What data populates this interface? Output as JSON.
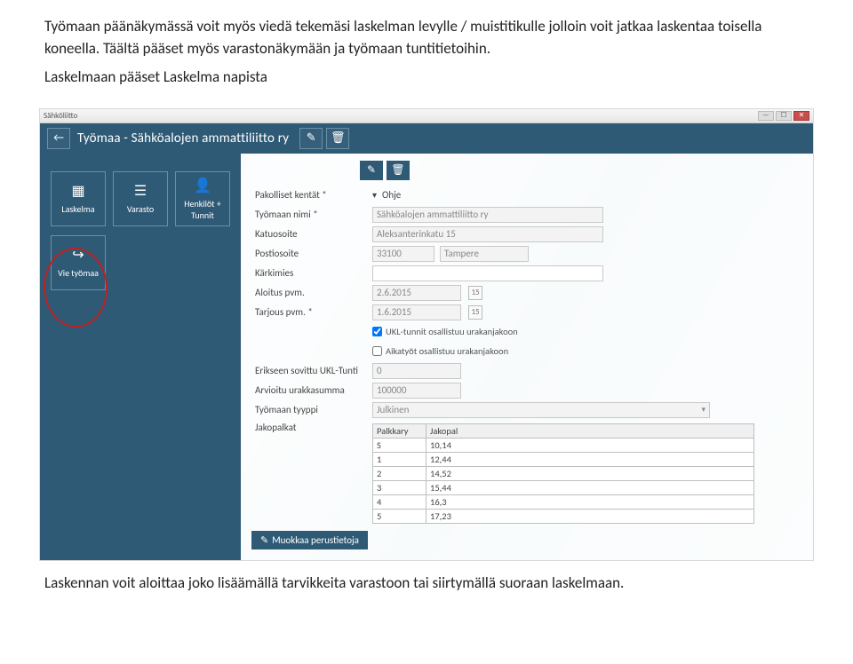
{
  "doc": {
    "p1": "Työmaan päänäkymässä voit myös viedä tekemäsi laskelman levylle / muistitikulle jolloin voit jatkaa laskentaa toisella koneella. Täältä pääset myös varastonäkymään ja työmaan tuntitietoihin.",
    "p2": "Laskelmaan pääset Laskelma napista",
    "p3": "Laskennan voit aloittaa joko lisäämällä tarvikkeita varastoon tai siirtymällä suoraan laskelmaan."
  },
  "window": {
    "app_label": "Sähköliitto",
    "min": "—",
    "max": "☐",
    "close": "✕"
  },
  "header": {
    "back": "←",
    "title": "Työmaa - Sähköalojen ammattiliitto ry",
    "edit": "✎",
    "delete": "🗑"
  },
  "sidebar": {
    "tiles": [
      {
        "icon": "▦",
        "label": "Laskelma"
      },
      {
        "icon": "☰",
        "label": "Varasto"
      },
      {
        "icon": "👤",
        "label": "Henkilöt + Tunnit"
      },
      {
        "icon": "↪",
        "label": "Vie työmaa"
      }
    ]
  },
  "toolbar": {
    "edit": "✎",
    "delete": "🗑"
  },
  "form": {
    "required_label": "Pakolliset kentät *",
    "help_label": "Ohje",
    "name_label": "Työmaan nimi *",
    "name_value": "Sähköalojen ammattiliitto ry",
    "street_label": "Katuosoite",
    "street_value": "Aleksanterinkatu 15",
    "post_label": "Postiosoite",
    "post_zip": "33100",
    "post_city": "Tampere",
    "foreman_label": "Kärkimies",
    "foreman_value": "",
    "start_label": "Aloitus pvm.",
    "start_value": "2.6.2015",
    "offer_label": "Tarjous pvm. *",
    "offer_value": "1.6.2015",
    "chk1": "UKL-tunnit osallistuu urakanjakoon",
    "chk2": "Aikatyöt osallistuu urakanjakoon",
    "ukl_label": "Erikseen sovittu UKL-Tunti",
    "ukl_value": "0",
    "est_label": "Arvioitu urakkasumma",
    "est_value": "100000",
    "type_label": "Työmaan tyyppi",
    "type_value": "Julkinen",
    "jako_label": "Jakopalkat",
    "jako_headers": [
      "Palkkary",
      "Jakopal"
    ],
    "jako_rows": [
      [
        "S",
        "10,14"
      ],
      [
        "1",
        "12,44"
      ],
      [
        "2",
        "14,52"
      ],
      [
        "3",
        "15,44"
      ],
      [
        "4",
        "16,3"
      ],
      [
        "5",
        "17,23"
      ]
    ],
    "muokkaa": "Muokkaa perustietoja"
  }
}
